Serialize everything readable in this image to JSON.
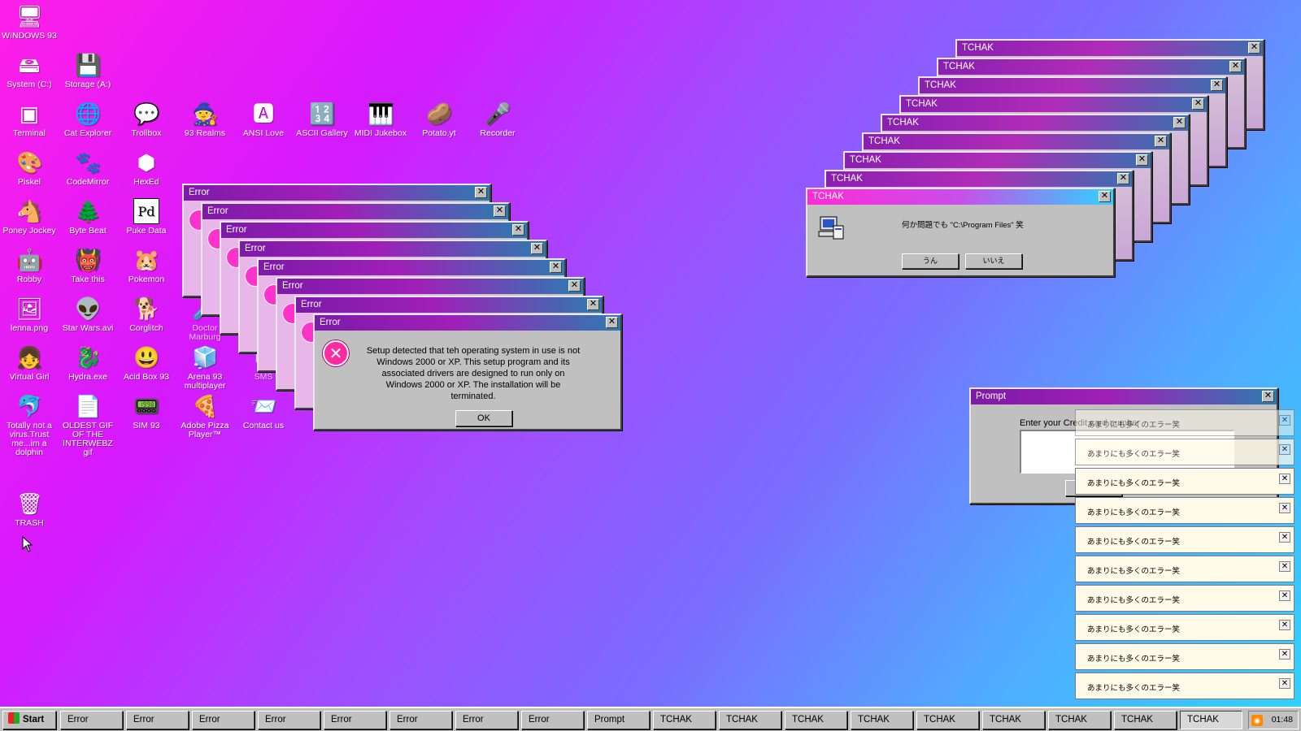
{
  "desktop": {
    "icons": [
      {
        "label": "WINDOWS 93",
        "glyph": "🖥"
      },
      {
        "label": "System (C:)",
        "glyph": "🖴"
      },
      {
        "label": "Storage (A:)",
        "glyph": "💾"
      },
      {
        "label": "Terminal",
        "glyph": "▣"
      },
      {
        "label": "Cat Explorer",
        "glyph": "🌐"
      },
      {
        "label": "Trollbox",
        "glyph": "💬"
      },
      {
        "label": "93 Realms",
        "glyph": "🧙"
      },
      {
        "label": "ANSI Love",
        "glyph": "🅰"
      },
      {
        "label": "ASCII Gallery",
        "glyph": "🔢"
      },
      {
        "label": "MIDI Jukebox",
        "glyph": "🎹"
      },
      {
        "label": "Potato.yt",
        "glyph": "🥔"
      },
      {
        "label": "Recorder",
        "glyph": "🎤"
      },
      {
        "label": "Piskel",
        "glyph": "🎨"
      },
      {
        "label": "CodeMirror",
        "glyph": "🐾"
      },
      {
        "label": "HexEd",
        "glyph": "⬢"
      },
      {
        "label": "Poney Jockey",
        "glyph": "🐴"
      },
      {
        "label": "Byte Beat",
        "glyph": "🌲"
      },
      {
        "label": "Puke Data",
        "glyph": "Pd"
      },
      {
        "label": "Robby",
        "glyph": "🤖"
      },
      {
        "label": "Take this",
        "glyph": "👹"
      },
      {
        "label": "Pokemon",
        "glyph": "🐹"
      },
      {
        "label": "lenna.png",
        "glyph": "🖼"
      },
      {
        "label": "Star Wars.avi",
        "glyph": "👽"
      },
      {
        "label": "Corglitch",
        "glyph": "🐕"
      },
      {
        "label": "Doctor Marburg",
        "glyph": "🧪"
      },
      {
        "label": "Virtual Girl",
        "glyph": "👧"
      },
      {
        "label": "Hydra.exe",
        "glyph": "🐉"
      },
      {
        "label": "Acid Box 93",
        "glyph": "😃"
      },
      {
        "label": "Arena 93 multiplayer",
        "glyph": "🧊"
      },
      {
        "label": "SMS",
        "glyph": "✉"
      },
      {
        "label": "Totally not a virus.Trust me...im a dolphin",
        "glyph": "🐬"
      },
      {
        "label": "OLDEST GIF OF THE INTERWEBZ gif",
        "glyph": "📄"
      },
      {
        "label": "SIM 93",
        "glyph": "📟"
      },
      {
        "label": "Adobe Pizza Player™",
        "glyph": "🍕"
      },
      {
        "label": "Contact us",
        "glyph": "📨"
      },
      {
        "label": "TRASH",
        "glyph": "🗑"
      }
    ]
  },
  "error_title": "Error",
  "error_dialog": {
    "title": "Error",
    "message": "Setup detected that teh operating system in use is not Windows 2000 or XP. This setup program and its associated drivers are designed to run only on Windows 2000 or XP. The installation will be terminated.",
    "ok": "OK"
  },
  "tchak_title": "TCHAK",
  "tchak_dialog": {
    "title": "TCHAK",
    "message": "何か問題でも \"C:\\Program Files\" 笑",
    "yes": "うん",
    "no": "いいえ"
  },
  "prompt": {
    "title": "Prompt",
    "label": "Enter your Credit card number"
  },
  "notification_text": "あまりにも多くのエラー笑",
  "taskbar": {
    "start": "Start",
    "buttons": [
      "Error",
      "Error",
      "Error",
      "Error",
      "Error",
      "Error",
      "Error",
      "Error",
      "Prompt",
      "TCHAK",
      "TCHAK",
      "TCHAK",
      "TCHAK",
      "TCHAK",
      "TCHAK",
      "TCHAK",
      "TCHAK",
      "TCHAK"
    ],
    "clock": "01:48"
  }
}
